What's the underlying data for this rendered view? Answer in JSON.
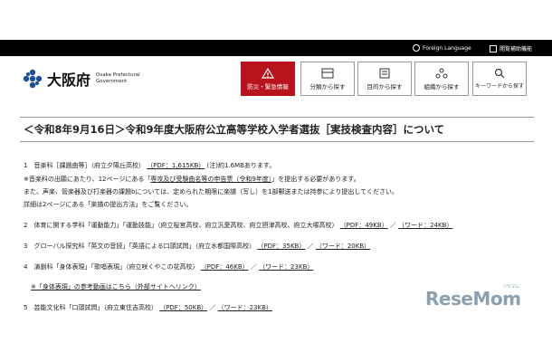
{
  "topbar": {
    "foreign_language": "Foreign Language",
    "viewing_assist": "閲覧補助機能"
  },
  "header": {
    "site_name": "大阪府",
    "site_sub_line1": "Osaka Prefectural",
    "site_sub_line2": "Government",
    "nav": [
      {
        "label": "防災・緊急情報",
        "icon": "warning-icon"
      },
      {
        "label": "分類から探す",
        "icon": "category-icon"
      },
      {
        "label": "目的から探す",
        "icon": "purpose-icon"
      },
      {
        "label": "組織から探す",
        "icon": "organization-icon"
      },
      {
        "label": "キーワードから探す",
        "icon": "keyword-icon"
      }
    ]
  },
  "page_title": "＜令和8年9月16日＞令和9年度大阪府公立高等学校入学者選抜［実技検査内容］について",
  "items": {
    "i1": {
      "head": "1　音楽科［課題曲等］（府立夕陽丘高校）",
      "pdf": "（PDF：1,615KB）",
      "note": "(注)約1.6MBあります。"
    },
    "i1_line2": {
      "pre": "※音楽科の出願にあたり、12ページにある「",
      "link": "専攻及び受験曲名等の申告票（令和9年度）",
      "post": "」を提出する必要があります。"
    },
    "i1_line3": "また、声楽、管楽器及び打楽器の課題bについては、定められた期限に楽譜（写し）を1部郵送または持参により提出してください。",
    "i1_line4": "詳細は2ページにある「楽譜の提出方法」をご覧ください。",
    "i2": {
      "head": "2　体育に関する学科「運動能力」「運動技能」（府立桜宮高校、府立汎愛高校、府立摂津高校、府立大塚高校）",
      "pdf": "（PDF：49KB）",
      "sep": "／",
      "word": "（ワード：24KB）"
    },
    "i3": {
      "head": "3　グローバル探究科「英文の音読」「英語による口頭試問」（府立水都国際高校）",
      "pdf": "（PDF：35KB）",
      "sep": "／",
      "word": "（ワード：20KB）"
    },
    "i4": {
      "head": "4　演劇科「身体表現」「歌唱表現」（府立咲くやこの花高校）",
      "pdf": "（PDF：46KB）",
      "sep": "／",
      "word": "（ワード：23KB）"
    },
    "i4_link": "※「身体表現」の参考動画はこちら（外部サイトへリンク）",
    "i5": {
      "head": "5　芸能文化科「口頭試問」（府立東住吉高校）",
      "pdf": "（PDF：50KB）",
      "sep": "／",
      "word": "（ワード：23KB）"
    }
  },
  "watermark": {
    "text": "ReseMom",
    "small": "リセマム"
  },
  "colors": {
    "red_button": "#b9141d",
    "topbar": "#000000",
    "watermark": "#8ba0b1"
  }
}
